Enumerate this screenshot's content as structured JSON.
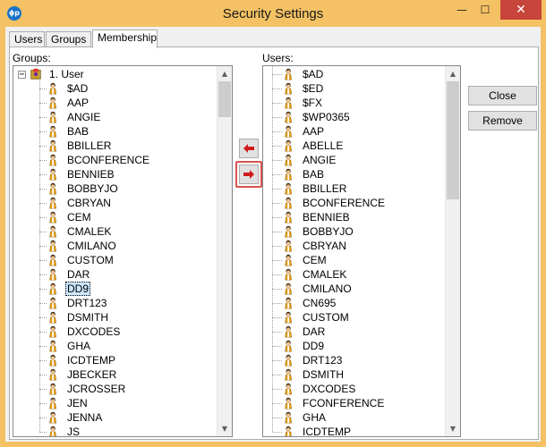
{
  "window": {
    "title": "Security Settings",
    "app_icon_glyph": "ɸp",
    "minimize_glyph": "—",
    "maximize_glyph": "☐",
    "close_glyph": "✕"
  },
  "tabs": [
    {
      "label": "Users"
    },
    {
      "label": "Groups"
    },
    {
      "label": "Membership"
    }
  ],
  "groups_panel": {
    "label": "Groups:",
    "root": {
      "label": "1. User",
      "expander": "−"
    },
    "items": [
      "$AD",
      "AAP",
      "ANGIE",
      "BAB",
      "BBILLER",
      "BCONFERENCE",
      "BENNIEB",
      "BOBBYJO",
      "CBRYAN",
      "CEM",
      "CMALEK",
      "CMILANO",
      "CUSTOM",
      "DAR",
      "DD9",
      "DRT123",
      "DSMITH",
      "DXCODES",
      "GHA",
      "ICDTEMP",
      "JBECKER",
      "JCROSSER",
      "JEN",
      "JENNA",
      "JS"
    ],
    "selected": "DD9"
  },
  "users_panel": {
    "label": "Users:",
    "items": [
      "$AD",
      "$ED",
      "$FX",
      "$WP0365",
      "AAP",
      "ABELLE",
      "ANGIE",
      "BAB",
      "BBILLER",
      "BCONFERENCE",
      "BENNIEB",
      "BOBBYJO",
      "CBRYAN",
      "CEM",
      "CMALEK",
      "CMILANO",
      "CN695",
      "CUSTOM",
      "DAR",
      "DD9",
      "DRT123",
      "DSMITH",
      "DXCODES",
      "FCONFERENCE",
      "GHA",
      "ICDTEMP"
    ]
  },
  "buttons": {
    "close_label": "Close",
    "remove_label": "Remove"
  },
  "icons": {
    "add_to_group": "arrow-left-icon",
    "move_to_users": "arrow-right-icon",
    "user": "person-icon",
    "group": "group-icon"
  },
  "colors": {
    "title_bar": "#f4c264",
    "close_button": "#c7453a",
    "arrow_red": "#d11a1a",
    "selection": "#cce8ff"
  }
}
